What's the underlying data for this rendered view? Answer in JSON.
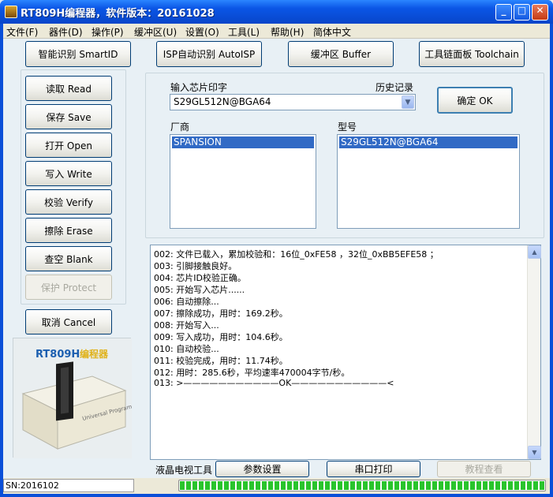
{
  "window": {
    "title": "RT809H编程器，软件版本：20161028",
    "minimize": "_",
    "maximize": "□",
    "close": "✕"
  },
  "menu": [
    "文件(F)",
    "器件(D)",
    "操作(P)",
    "缓冲区(U)",
    "设置(O)",
    "工具(L)",
    "帮助(H)",
    "简体中文"
  ],
  "top_buttons": [
    "智能识别 SmartID",
    "ISP自动识别 AutoISP",
    "缓冲区 Buffer",
    "工具链面板 Toolchain"
  ],
  "side_buttons": [
    {
      "label": "读取 Read",
      "enabled": true
    },
    {
      "label": "保存 Save",
      "enabled": true
    },
    {
      "label": "打开 Open",
      "enabled": true
    },
    {
      "label": "写入 Write",
      "enabled": true
    },
    {
      "label": "校验 Verify",
      "enabled": true
    },
    {
      "label": "擦除 Erase",
      "enabled": true
    },
    {
      "label": "查空 Blank",
      "enabled": true
    },
    {
      "label": "保护 Protect",
      "enabled": false
    }
  ],
  "cancel_button": "取消 Cancel",
  "chip": {
    "input_label": "输入芯片印字",
    "history_label": "历史记录",
    "input_value": "S29GL512N@BGA64",
    "ok_button": "确定 OK",
    "vendor_label": "厂商",
    "model_label": "型号",
    "vendor_selected": "SPANSION",
    "model_selected": "S29GL512N@BGA64"
  },
  "log": [
    "002: 文件已载入，累加校验和：16位_0xFE58 ，32位_0xBB5EFE58 ；",
    "003: 引脚接触良好。",
    "004: 芯片ID校验正确。",
    "005: 开始写入芯片......",
    "006: 自动擦除...",
    "007: 擦除成功，用时：169.2秒。",
    "008: 开始写入...",
    "009: 写入成功，用时：104.6秒。",
    "010: 自动校验...",
    "011: 校验完成，用时：11.74秒。",
    "012: 用时：285.6秒，平均速率470004字节/秒。",
    "013: >———————————OK———————————<"
  ],
  "product": {
    "name": "RT809H",
    "name_cn": "编程器",
    "device_text": "Universal Programmer"
  },
  "bottom": {
    "lcd_label": "液晶电视工具",
    "params_button": "参数设置",
    "serial_button": "串口打印",
    "tutorial_button": "教程查看"
  },
  "status": {
    "sn": "SN:2016102",
    "progress": 1.0
  },
  "colors": {
    "title_bar": "#0b56e6",
    "selection": "#316ac5",
    "progress": "#29c42c"
  }
}
